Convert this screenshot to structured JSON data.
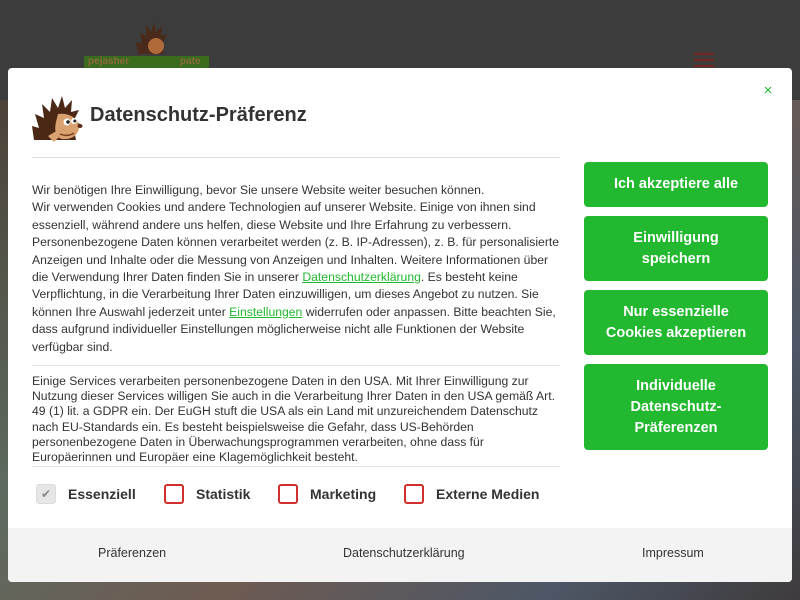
{
  "site": {
    "logo_left": "pejasher",
    "logo_right": "pate"
  },
  "modal": {
    "title": "Datenschutz-Präferenz",
    "description": {
      "p1": "Wir benötigen Ihre Einwilligung, bevor Sie unsere Website weiter besuchen können.",
      "p2_before_link": "Wir verwenden Cookies und andere Technologien auf unserer Website. Einige von ihnen sind essenziell, während andere uns helfen, diese Website und Ihre Erfahrung zu verbessern. Personenbezogene Daten können verarbeitet werden (z. B. IP-Adressen), z. B. für personalisierte Anzeigen und Inhalte oder die Messung von Anzeigen und Inhalten. Weitere Informationen über die Verwendung Ihrer Daten finden Sie in unserer ",
      "link_privacy": "Datenschutzerklärung",
      "p2_middle": ". Es besteht keine Verpflichtung, in die Verarbeitung Ihrer Daten einzuwilligen, um dieses Angebot zu nutzen. Sie können Ihre Auswahl jederzeit unter ",
      "link_settings": "Einstellungen",
      "p2_after_link": " widerrufen oder anpassen. Bitte beachten Sie, dass aufgrund individueller Einstellungen möglicherweise nicht alle Funktionen der Website verfügbar sind."
    },
    "usa_notice": "Einige Services verarbeiten personenbezogene Daten in den USA. Mit Ihrer Einwilligung zur Nutzung dieser Services willigen Sie auch in die Verarbeitung Ihrer Daten in den USA gemäß Art. 49 (1) lit. a GDPR ein. Der EuGH stuft die USA als ein Land mit unzureichendem Datenschutz nach EU-Standards ein. Es besteht beispielsweise die Gefahr, dass US-Behörden personenbezogene Daten in Überwachungsprogrammen verarbeiten, ohne dass für Europäerinnen und Europäer eine Klagemöglichkeit besteht.",
    "categories": [
      {
        "label": "Essenziell",
        "checked": true,
        "locked": true
      },
      {
        "label": "Statistik",
        "checked": false,
        "locked": false
      },
      {
        "label": "Marketing",
        "checked": false,
        "locked": false
      },
      {
        "label": "Externe Medien",
        "checked": false,
        "locked": false
      }
    ],
    "buttons": {
      "accept_all": "Ich akzeptiere alle",
      "save_consent": "Einwilligung speichern",
      "essential_only": "Nur essenzielle Cookies akzeptieren",
      "individual": "Individuelle Datenschutz-Präferenzen"
    },
    "footer": {
      "preferences": "Präferenzen",
      "privacy": "Datenschutzerklärung",
      "imprint": "Impressum"
    },
    "close_icon": "×",
    "check_icon": "✔"
  },
  "colors": {
    "accent": "#22b82f",
    "checkbox_border": "#cf2f2f",
    "text": "#333333"
  }
}
